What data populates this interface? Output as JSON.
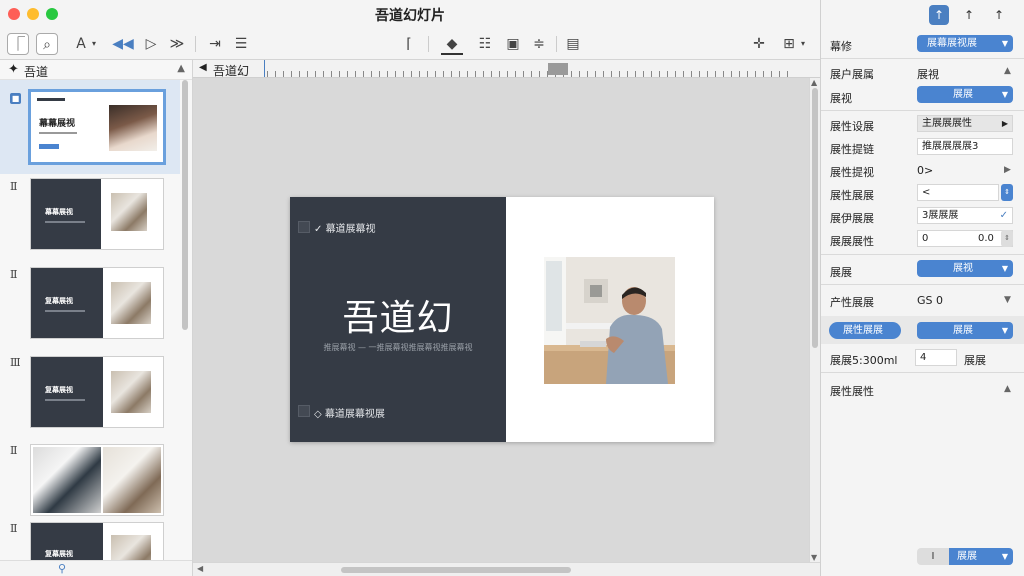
{
  "window": {
    "title": "吾道幻灯片"
  },
  "navigator": {
    "title": "吾道",
    "thumbs": [
      {
        "num": "",
        "title": "幕幕展视"
      },
      {
        "num": "Ⅱ",
        "title": "幕幕展视"
      },
      {
        "num": "Ⅱ",
        "title": "复幕展视"
      },
      {
        "num": "Ⅲ",
        "title": "复幕展视"
      },
      {
        "num": "Ⅱ",
        "title": ""
      },
      {
        "num": "Ⅱ",
        "title": "复幕展视"
      }
    ]
  },
  "canvas": {
    "ruler_title": "吾道幻"
  },
  "slide": {
    "top_text": "幕道展幕视",
    "title": "吾道幻",
    "subtitle": "推展幕视 — 一推展幕视推展幕视推展幕视",
    "bottom_text": "幕道展幕视展"
  },
  "inspector": {
    "tabs": [
      "↑",
      "↑",
      "↑"
    ],
    "format_label": "幕修",
    "format_value": "展幕展视展",
    "attr_label": "展户展属",
    "attr_value": "展視",
    "style_label": "展视",
    "style_value": "展展",
    "rows": [
      {
        "label": "展性设展",
        "value": "主展展展性"
      },
      {
        "label": "展性提链",
        "value": "推展展展展3"
      },
      {
        "label": "展性提视",
        "value": "0>"
      },
      {
        "label": "展性展展",
        "value": "<"
      },
      {
        "label": "展伊展展",
        "value": "3展展展"
      },
      {
        "label": "展展展性",
        "value": "0",
        "value2": "0.0"
      }
    ],
    "fill_label": "展展",
    "fill_value": "展视",
    "border_label": "产性展展",
    "border_value": "GS 0",
    "btn_left": "展性展展",
    "btn_right": "展展",
    "size_label": "展展5:300ml",
    "size_value": "4",
    "size_unit": "展展",
    "more_label": "展性展性",
    "footer_a": "Ⅰ",
    "footer_b": "展展"
  }
}
